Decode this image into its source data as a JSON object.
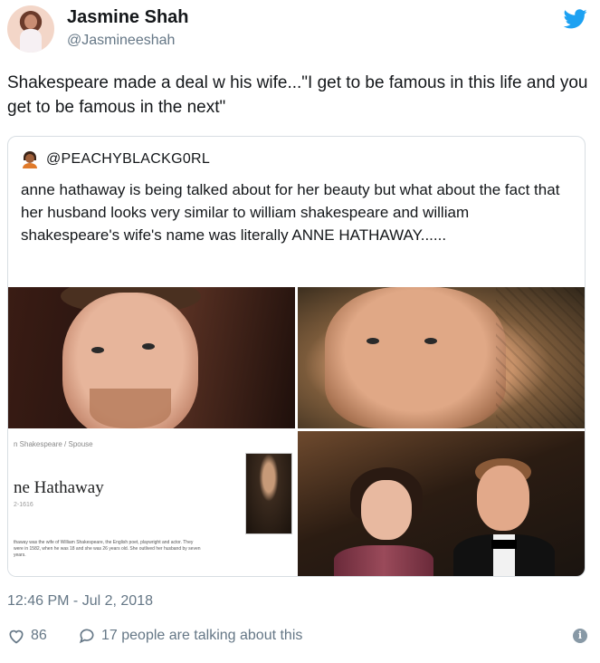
{
  "author": {
    "name": "Jasmine Shah",
    "handle": "@Jasmineeshah"
  },
  "tweet": {
    "text": "Shakespeare made a deal w his wife...\"I get to be famous in this life and you get to be famous in the next\"",
    "timestamp": "12:46 PM - Jul 2, 2018"
  },
  "quoted_tweet": {
    "handle": "@PEACHYBLACKG0RL",
    "text": "anne hathaway is being talked about for her beauty but what about the fact that her husband looks very similar to william shakespeare and william shakespeare's wife's name was literally ANNE HATHAWAY......",
    "wiki_card": {
      "breadcrumb": "n Shakespeare / Spouse",
      "title": "ne Hathaway",
      "years": "2-1616",
      "body": "thaway was the wife of William Shakespeare, the English poet, playwright and actor. They were in 1582, when he was 18 and she was 26 years old. She outlived her husband by seven years."
    }
  },
  "actions": {
    "like_count": "86",
    "talking": "17 people are talking about this"
  },
  "icons": {
    "brand": "twitter-bird-icon",
    "like": "heart-icon",
    "reply": "speech-bubble-icon",
    "info": "info-icon"
  },
  "colors": {
    "brand_blue": "#1da1f2",
    "muted_text": "#657786",
    "border": "#d8dee3"
  }
}
